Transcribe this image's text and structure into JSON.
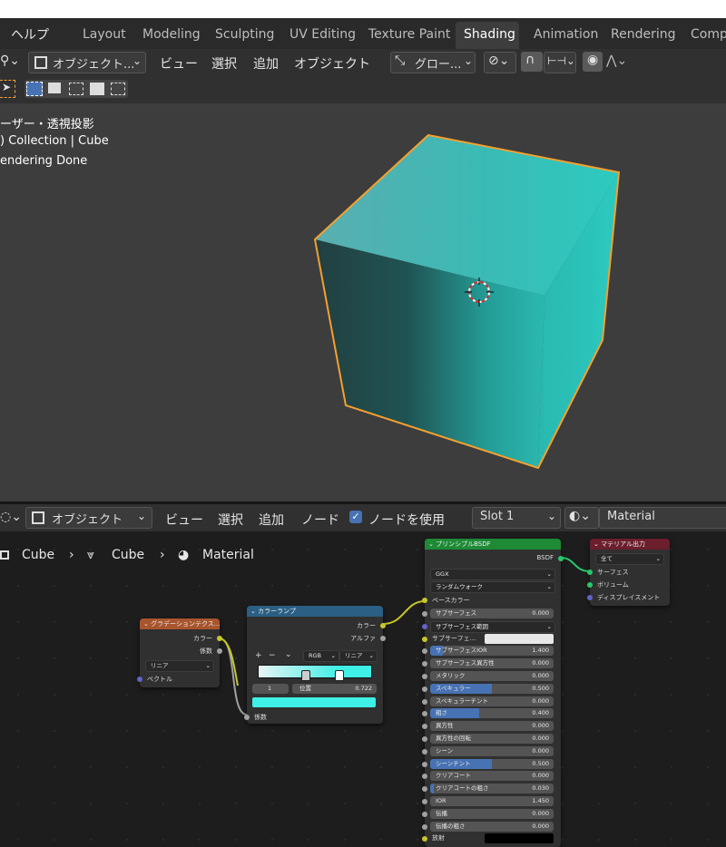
{
  "menubar": {
    "help": "ヘルプ",
    "workspaces": [
      "Layout",
      "Modeling",
      "Sculpting",
      "UV Editing",
      "Texture Paint",
      "Shading",
      "Animation",
      "Rendering",
      "Compo"
    ],
    "active": "Shading"
  },
  "viewport_header": {
    "mode": "オブジェクト...",
    "view": "ビュー",
    "select": "選択",
    "add": "追加",
    "object": "オブジェクト",
    "transform": "グロー..."
  },
  "viewport": {
    "info_line1": "ーザー・透視投影",
    "info_line2": ") Collection | Cube",
    "info_line3": "endering Done",
    "cube_color": "#2ec2b9",
    "outline_color": "#f5a030"
  },
  "node_header": {
    "mode": "オブジェクト",
    "view": "ビュー",
    "select": "選択",
    "add": "追加",
    "node": "ノード",
    "use_nodes": "ノードを使用",
    "slot": "Slot 1",
    "material": "Material"
  },
  "breadcrumb": [
    "Cube",
    "Cube",
    "Material"
  ],
  "gradient_node": {
    "title": "グラデーションテクス...",
    "out_color": "カラー",
    "out_fac": "係数",
    "type": "リニア",
    "in_vector": "ベクトル"
  },
  "colorramp_node": {
    "title": "カラーランプ",
    "out_color": "カラー",
    "out_alpha": "アルファ",
    "plus": "+",
    "minus": "−",
    "mode": "RGB",
    "interp": "リニア",
    "index": "1",
    "pos_label": "位置",
    "pos_value": "0.722",
    "in_fac": "係数",
    "ramp_color": "#3ef0e6"
  },
  "bsdf_node": {
    "title": "プリンシプルBSDF",
    "out": "BSDF",
    "dist": "GGX",
    "sss_method": "ランダムウォーク",
    "base_color": "ベースカラー",
    "fields": [
      {
        "label": "サブサーフェス",
        "value": "0.000",
        "fill": 0
      },
      {
        "label": "サブサーフェス範囲",
        "value": "",
        "fill": 0,
        "dropdown": true
      },
      {
        "label": "サブサーフェ...",
        "value": "",
        "fill": 0,
        "swatch": true
      },
      {
        "label": "サブサーフェスIOR",
        "value": "1.400",
        "fill": 0.1
      },
      {
        "label": "サブサーフェス異方性",
        "value": "0.000",
        "fill": 0
      },
      {
        "label": "メタリック",
        "value": "0.000",
        "fill": 0
      },
      {
        "label": "スペキュラー",
        "value": "0.500",
        "fill": 0.5
      },
      {
        "label": "スペキュラーチント",
        "value": "0.000",
        "fill": 0
      },
      {
        "label": "粗さ",
        "value": "0.400",
        "fill": 0.4
      },
      {
        "label": "異方性",
        "value": "0.000",
        "fill": 0
      },
      {
        "label": "異方性の回転",
        "value": "0.000",
        "fill": 0
      },
      {
        "label": "シーン",
        "value": "0.000",
        "fill": 0
      },
      {
        "label": "シーンチント",
        "value": "0.500",
        "fill": 0.5
      },
      {
        "label": "クリアコート",
        "value": "0.000",
        "fill": 0
      },
      {
        "label": "クリアコートの粗さ",
        "value": "0.030",
        "fill": 0.03
      },
      {
        "label": "IOR",
        "value": "1.450",
        "fill": 0
      },
      {
        "label": "伝播",
        "value": "0.000",
        "fill": 0
      },
      {
        "label": "伝播の粗さ",
        "value": "0.000",
        "fill": 0
      },
      {
        "label": "放射",
        "value": "",
        "fill": 0,
        "swatch_dark": true
      }
    ]
  },
  "output_node": {
    "title": "マテリアル出力",
    "target": "全て",
    "surface": "サーフェス",
    "volume": "ボリューム",
    "displacement": "ディスプレイスメント"
  }
}
